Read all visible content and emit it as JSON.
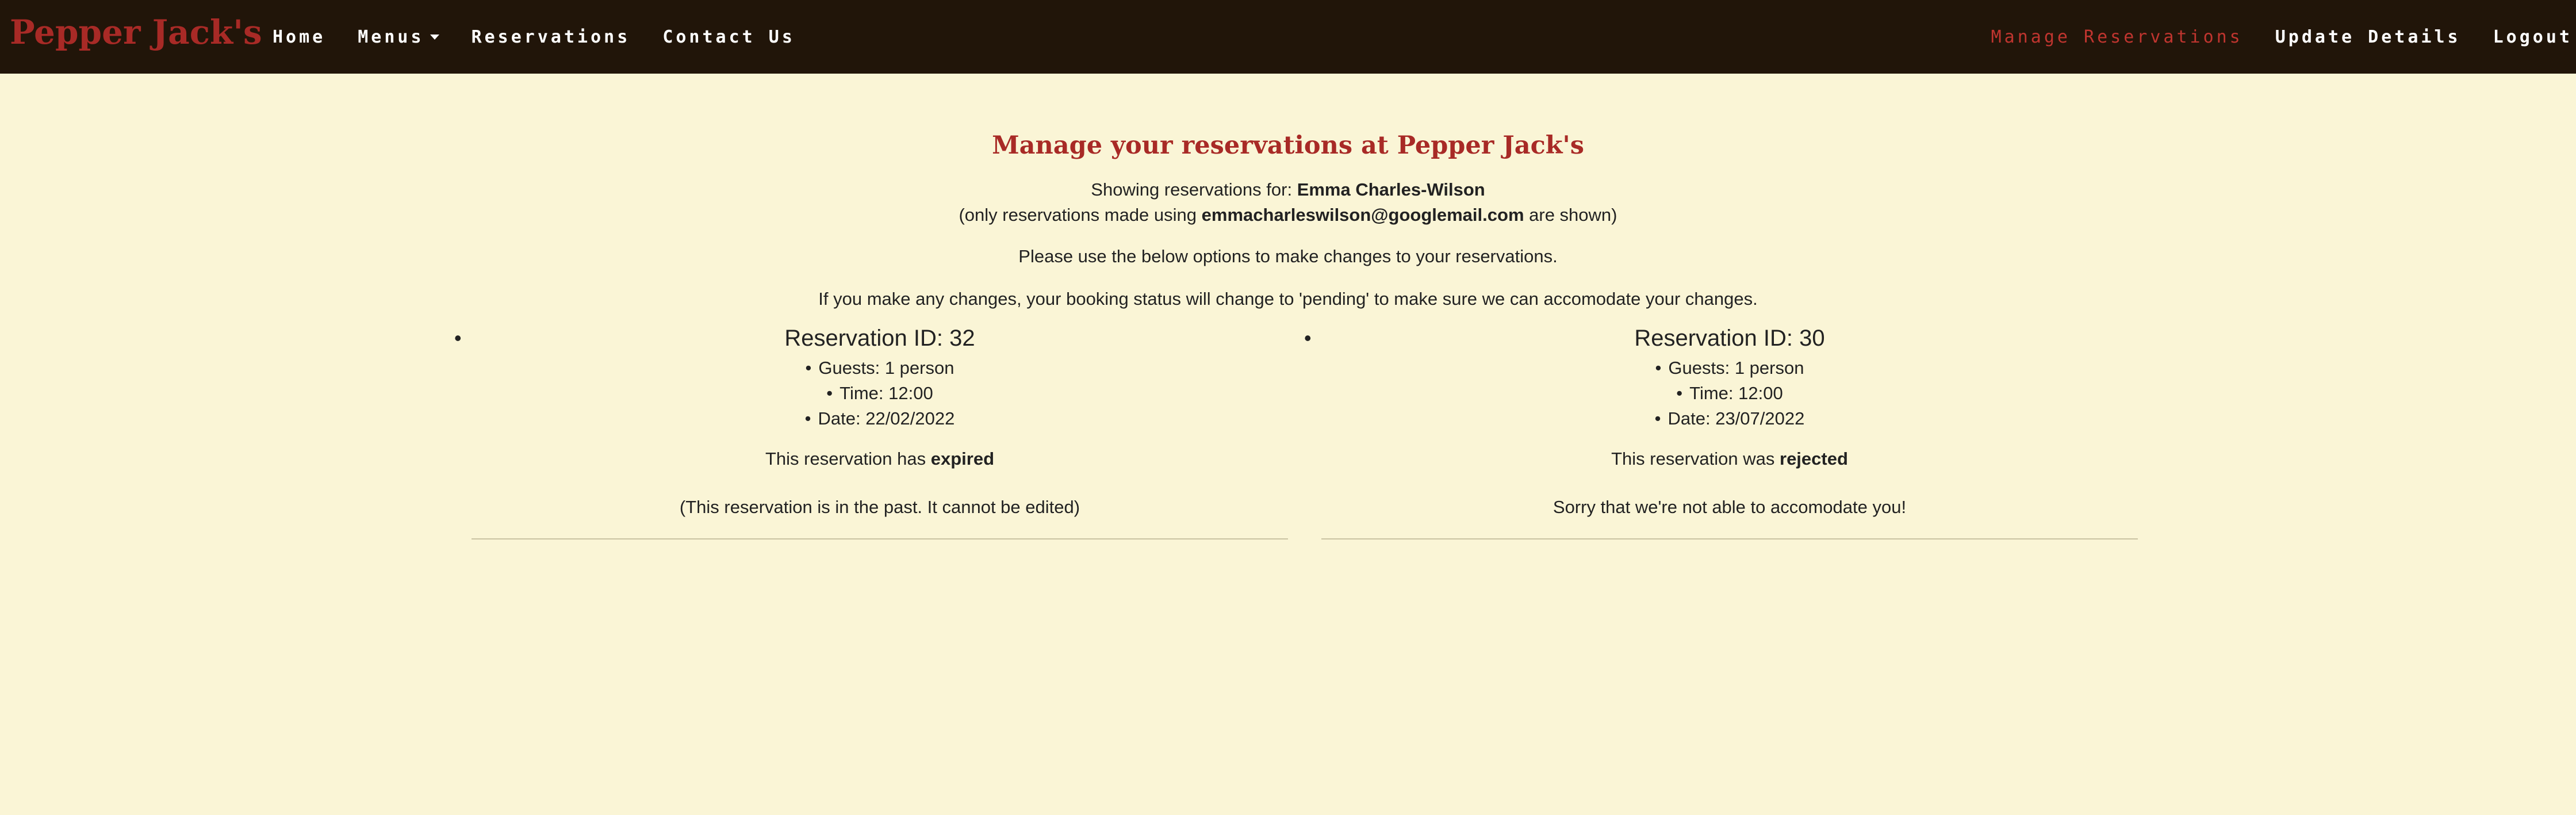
{
  "navbar": {
    "brand": "Pepper Jack's",
    "left_links": [
      {
        "label": "Home"
      },
      {
        "label": "Menus"
      },
      {
        "label": "Reservations"
      },
      {
        "label": "Contact Us"
      }
    ],
    "right_links": [
      {
        "label": "Manage Reservations",
        "active": true
      },
      {
        "label": "Update Details"
      },
      {
        "label": "Logout"
      }
    ],
    "colors": {
      "background": "#211509",
      "brand": "#a82a26",
      "active_link": "#c0352f",
      "link": "#ffffff"
    }
  },
  "page": {
    "background": "#faf5d6",
    "title": "Manage your reservations at Pepper Jack's",
    "showing_prefix": "Showing reservations for:",
    "user_name": "Emma Charles-Wilson",
    "email_prefix": "(only reservations made using",
    "email": "emmacharleswilson@googlemail.com",
    "email_suffix": "are shown)",
    "instructions": "Please use the below options to make changes to your reservations.",
    "pending_notice": "If you make any changes, your booking status will change to 'pending' to make sure we can accomodate your changes."
  },
  "reservations": [
    {
      "id_label": "Reservation ID: 32",
      "details": [
        "Guests: 1 person",
        "Time: 12:00",
        "Date: 22/02/2022"
      ],
      "status_prefix": "This reservation has",
      "status_word": "expired",
      "note": "(This reservation is in the past. It cannot be edited)"
    },
    {
      "id_label": "Reservation ID: 30",
      "details": [
        "Guests: 1 person",
        "Time: 12:00",
        "Date: 23/07/2022"
      ],
      "status_prefix": "This reservation was",
      "status_word": "rejected",
      "note": "Sorry that we're not able to accomodate you!"
    }
  ]
}
